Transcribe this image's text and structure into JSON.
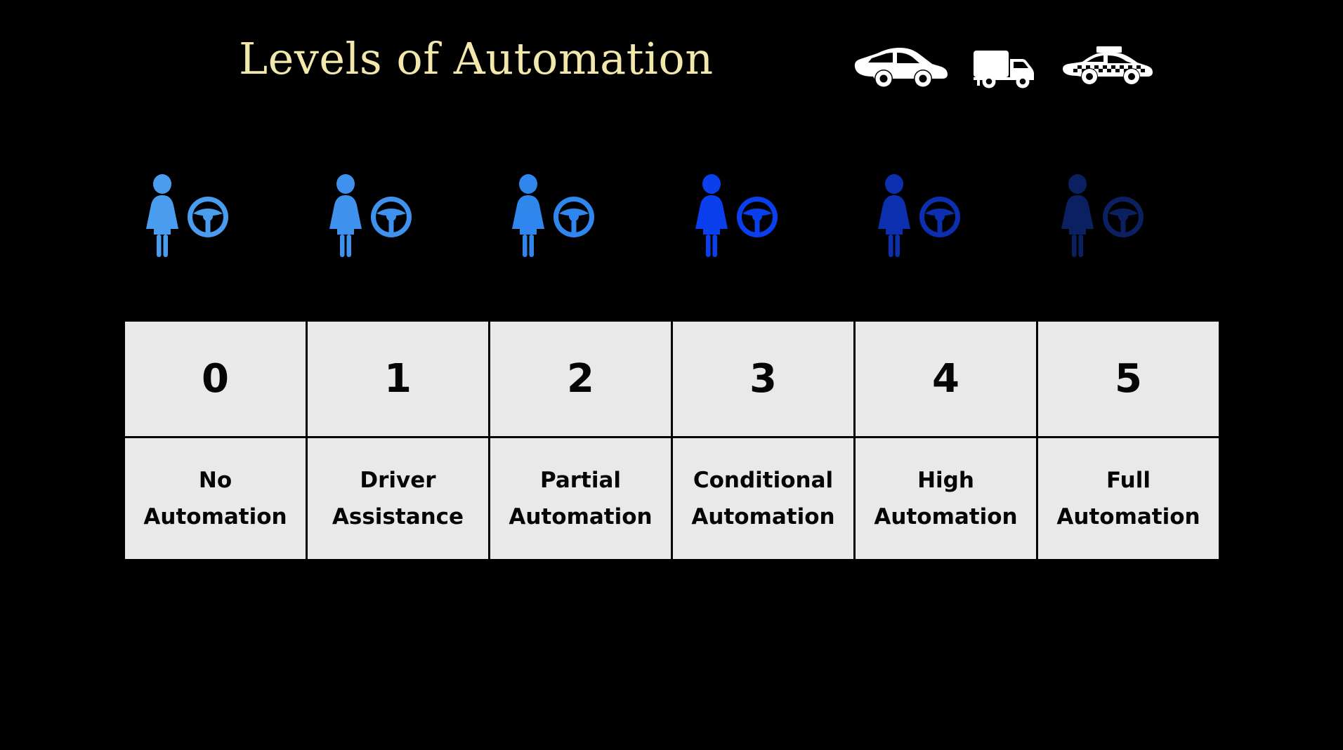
{
  "header": {
    "title": "Levels of Automation",
    "title_color": "#F2E8AC",
    "vehicles": [
      {
        "name": "car-icon",
        "label": "car",
        "color": "#FFFFFF"
      },
      {
        "name": "truck-icon",
        "label": "truck",
        "color": "#FFFFFF"
      },
      {
        "name": "taxi-icon",
        "label": "taxi",
        "color": "#FFFFFF"
      }
    ]
  },
  "background_color": "#000000",
  "figures": [
    {
      "person_icon": "person-icon",
      "wheel_icon": "steering-wheel-icon",
      "color": "#4A9CEF"
    },
    {
      "person_icon": "person-icon",
      "wheel_icon": "steering-wheel-icon",
      "color": "#3E92EE"
    },
    {
      "person_icon": "person-icon",
      "wheel_icon": "steering-wheel-icon",
      "color": "#2F86ED"
    },
    {
      "person_icon": "person-icon",
      "wheel_icon": "steering-wheel-icon",
      "color": "#0A3FEE"
    },
    {
      "person_icon": "person-icon",
      "wheel_icon": "steering-wheel-icon",
      "color": "#0B2FAF"
    },
    {
      "person_icon": "person-icon",
      "wheel_icon": "steering-wheel-icon",
      "color": "#0B2060"
    }
  ],
  "table": {
    "cell_background": "#E9E9E9",
    "border_color": "#000000",
    "text_color": "#050505",
    "columns": [
      {
        "level": "0",
        "name_line1": "No",
        "name_line2": "Automation"
      },
      {
        "level": "1",
        "name_line1": "Driver",
        "name_line2": "Assistance"
      },
      {
        "level": "2",
        "name_line1": "Partial",
        "name_line2": "Automation"
      },
      {
        "level": "3",
        "name_line1": "Conditional",
        "name_line2": "Automation"
      },
      {
        "level": "4",
        "name_line1": "High",
        "name_line2": "Automation"
      },
      {
        "level": "5",
        "name_line1": "Full",
        "name_line2": "Automation"
      }
    ]
  }
}
